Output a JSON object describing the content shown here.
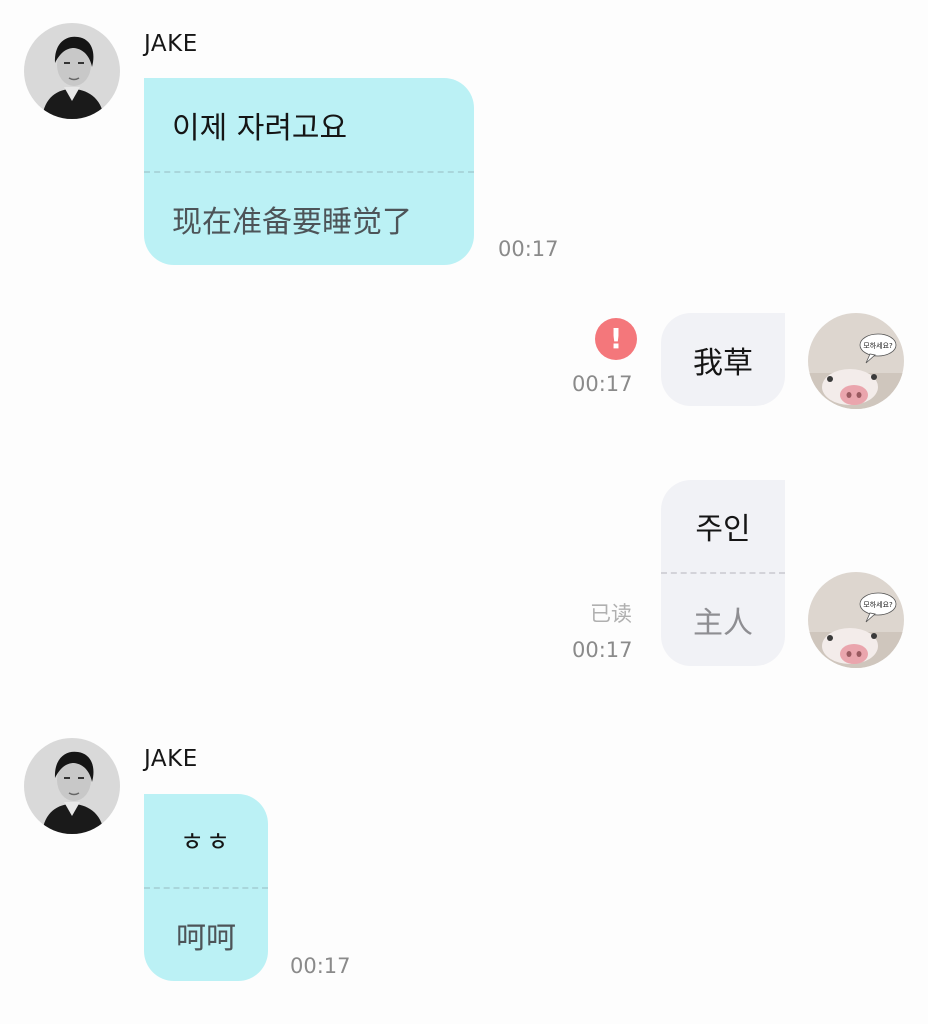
{
  "messages": [
    {
      "sender": "JAKE",
      "original": "이제 자려고요",
      "translation": "现在准备要睡觉了",
      "time": "00:17"
    },
    {
      "original": "我草",
      "time": "00:17",
      "status": "failed"
    },
    {
      "original": "주인",
      "translation": "主人",
      "read_label": "已读",
      "time": "00:17"
    },
    {
      "sender": "JAKE",
      "original": "ㅎㅎ",
      "translation": "呵呵",
      "time": "00:17"
    }
  ],
  "icons": {
    "error": "exclamation-circle-icon",
    "contact_avatar": "portrait-avatar",
    "self_avatar": "pig-avatar"
  },
  "sticker_text": "모하세요?",
  "error_glyph": "!",
  "colors": {
    "incoming_bubble": "#bbf1f5",
    "outgoing_bubble": "#f1f2f6",
    "error": "#f4777b",
    "timestamp": "#8a8a8a"
  }
}
